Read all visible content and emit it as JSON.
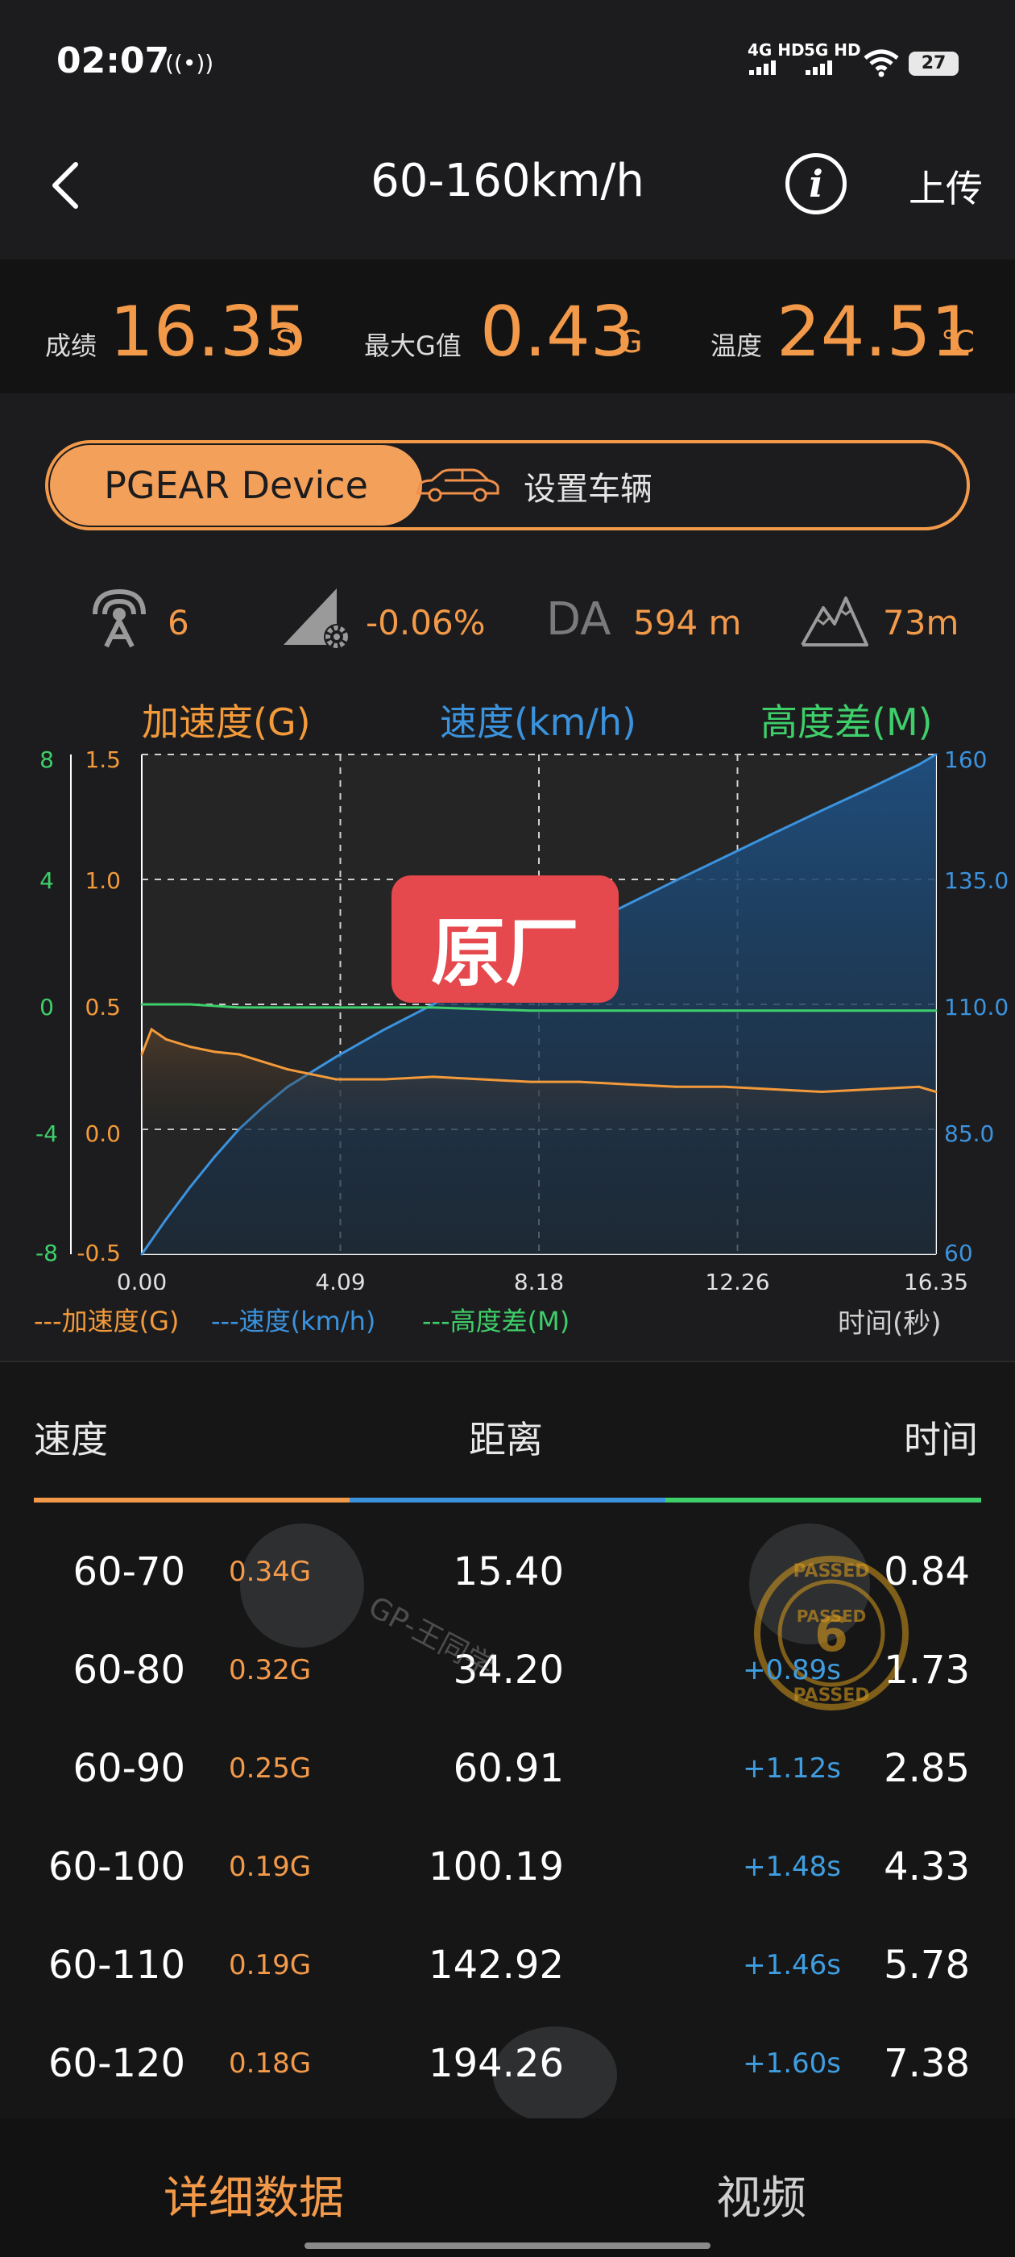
{
  "status_bar": {
    "time": "02:07",
    "signal1": "4G HD",
    "signal2": "5G HD",
    "battery": "27"
  },
  "header": {
    "title": "60-160km/h",
    "upload_label": "上传",
    "info_label": "i"
  },
  "results": {
    "score_label": "成绩",
    "score_value": "16.35",
    "score_unit": "S",
    "maxg_label": "最大G值",
    "maxg_value": "0.43",
    "maxg_unit": "G",
    "temp_label": "温度",
    "temp_value": "24.51",
    "temp_unit": "℃"
  },
  "toggle": {
    "device_label": "PGEAR Device",
    "vehicle_label": "设置车辆"
  },
  "stats": {
    "satellites": "6",
    "slope": "-0.06%",
    "da_label": "DA",
    "da_value": "594 m",
    "altitude": "73m"
  },
  "chart_heads": {
    "accel": "加速度(G)",
    "speed": "速度(km/h)",
    "height": "高度差(M)"
  },
  "overlay_label": "原厂",
  "chart_data": {
    "type": "line",
    "title": "",
    "xlabel": "时间(秒)",
    "x_ticks": [
      "0.00",
      "4.09",
      "8.18",
      "12.26",
      "16.35"
    ],
    "xlim": [
      0,
      16.35
    ],
    "grid": true,
    "legend_position": "bottom",
    "axes": {
      "height": {
        "label": "高度差(M)",
        "ticks": [
          "8",
          "4",
          "0",
          "-4",
          "-8"
        ],
        "lim": [
          -8,
          8
        ],
        "color": "#3ecf6a"
      },
      "accel": {
        "label": "加速度(G)",
        "ticks": [
          "1.5",
          "1.0",
          "0.5",
          "0.0",
          "-0.5"
        ],
        "lim": [
          -0.5,
          1.5
        ],
        "color": "#f39a3a"
      },
      "speed": {
        "label": "速度(km/h)",
        "ticks": [
          "160",
          "135.0",
          "110.0",
          "85.0",
          "60"
        ],
        "lim": [
          60,
          160
        ],
        "color": "#3b93de"
      }
    },
    "legend": [
      "---加速度(G)",
      "---速度(km/h)",
      "---高度差(M)"
    ],
    "series": [
      {
        "name": "速度(km/h)",
        "axis": "speed",
        "x": [
          0,
          0.5,
          1,
          1.5,
          2,
          2.5,
          3,
          4,
          5,
          6,
          7,
          8,
          9,
          10,
          11,
          12,
          13,
          14,
          15,
          16,
          16.35
        ],
        "values": [
          60,
          67,
          73.5,
          79.5,
          85,
          89.5,
          93.5,
          99.5,
          105,
          110,
          115.2,
          120.3,
          125.2,
          130,
          134.8,
          139.5,
          144.2,
          148.8,
          153.3,
          158,
          160
        ]
      },
      {
        "name": "加速度(G)",
        "axis": "accel",
        "x": [
          0,
          0.2,
          0.5,
          1,
          1.5,
          2,
          2.5,
          3,
          3.5,
          4,
          5,
          6,
          7,
          8,
          9,
          10,
          11,
          12,
          13,
          14,
          15,
          16,
          16.35
        ],
        "values": [
          0.3,
          0.4,
          0.36,
          0.33,
          0.31,
          0.3,
          0.27,
          0.24,
          0.22,
          0.2,
          0.2,
          0.21,
          0.2,
          0.19,
          0.19,
          0.18,
          0.17,
          0.17,
          0.16,
          0.15,
          0.16,
          0.17,
          0.15
        ]
      },
      {
        "name": "高度差(M)",
        "axis": "height",
        "x": [
          0,
          1,
          2,
          4,
          6,
          8,
          10,
          12,
          14,
          16.35
        ],
        "values": [
          0,
          0,
          -0.1,
          -0.1,
          -0.1,
          -0.2,
          -0.2,
          -0.2,
          -0.2,
          -0.2
        ]
      }
    ]
  },
  "table": {
    "headers": {
      "speed": "速度",
      "distance": "距离",
      "time": "时间"
    },
    "rows": [
      {
        "range": "60-70",
        "g": "0.34G",
        "distance": "15.40",
        "diff": "",
        "time": "0.84"
      },
      {
        "range": "60-80",
        "g": "0.32G",
        "distance": "34.20",
        "diff": "+0.89s",
        "time": "1.73"
      },
      {
        "range": "60-90",
        "g": "0.25G",
        "distance": "60.91",
        "diff": "+1.12s",
        "time": "2.85"
      },
      {
        "range": "60-100",
        "g": "0.19G",
        "distance": "100.19",
        "diff": "+1.48s",
        "time": "4.33"
      },
      {
        "range": "60-110",
        "g": "0.19G",
        "distance": "142.92",
        "diff": "+1.46s",
        "time": "5.78"
      },
      {
        "range": "60-120",
        "g": "0.18G",
        "distance": "194.26",
        "diff": "+1.60s",
        "time": "7.38"
      }
    ],
    "watermark": "GP-王同学",
    "stamp_text": "PASSED",
    "stamp_number": "6"
  },
  "bottom_nav": {
    "details": "详细数据",
    "video": "视频"
  },
  "colors": {
    "accent_orange": "#f39a4a",
    "speed_blue": "#3b93de",
    "height_green": "#3ecf6a",
    "overlay_red": "#e5484d"
  }
}
